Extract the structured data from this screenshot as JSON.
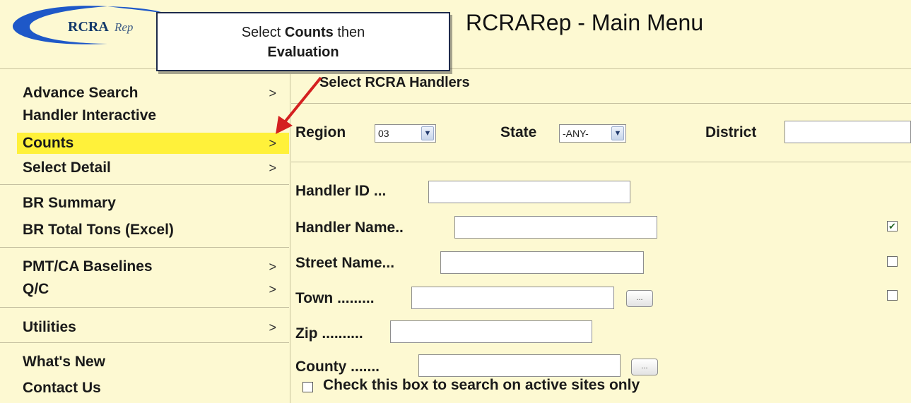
{
  "header": {
    "logo_text": "RCRA",
    "logo_subtext": "Rep",
    "title": "RCRARep - Main Menu"
  },
  "callout": {
    "prefix": "Select",
    "bold1": "Counts",
    "middle": "then",
    "bold2": "Evaluation"
  },
  "sidebar": {
    "items": [
      {
        "label": "Advance Search",
        "chevron": ">"
      },
      {
        "label": "Handler Interactive",
        "chevron": ""
      },
      {
        "label": "Counts",
        "chevron": ">"
      },
      {
        "label": "Select Detail",
        "chevron": ">"
      },
      {
        "label": "BR Summary",
        "chevron": ""
      },
      {
        "label": "BR Total Tons (Excel)",
        "chevron": ""
      },
      {
        "label": "PMT/CA Baselines",
        "chevron": ">"
      },
      {
        "label": "Q/C",
        "chevron": ">"
      },
      {
        "label": "Utilities",
        "chevron": ">"
      },
      {
        "label": "What's New",
        "chevron": ""
      },
      {
        "label": "Contact Us",
        "chevron": ""
      }
    ]
  },
  "main": {
    "section_title": "Select RCRA Handlers",
    "region": {
      "label": "Region",
      "value": "03"
    },
    "state": {
      "label": "State",
      "value": "-ANY-"
    },
    "district": {
      "label": "District",
      "value": ""
    },
    "fields": {
      "handler_id": {
        "label": "Handler ID ...",
        "value": ""
      },
      "handler_name": {
        "label": "Handler Name..",
        "value": "",
        "checked": true
      },
      "street_name": {
        "label": "Street Name...",
        "value": "",
        "checked": false
      },
      "town": {
        "label": "Town .........",
        "value": "",
        "button": "...",
        "checked": false
      },
      "zip": {
        "label": "Zip ..........",
        "value": ""
      },
      "county": {
        "label": "County .......",
        "value": "",
        "button": "..."
      }
    },
    "active_only": {
      "label": "Check this box to search on active sites only",
      "checked": false
    }
  },
  "colors": {
    "page_bg": "#fdf9d2",
    "highlight": "#fff13a",
    "arrow": "#d42020",
    "logo_swoosh": "#1e58c8"
  },
  "icons": {
    "chevron": "chevron-right-icon",
    "check": "checkmark-icon",
    "dropdown": "dropdown-arrow-icon"
  }
}
